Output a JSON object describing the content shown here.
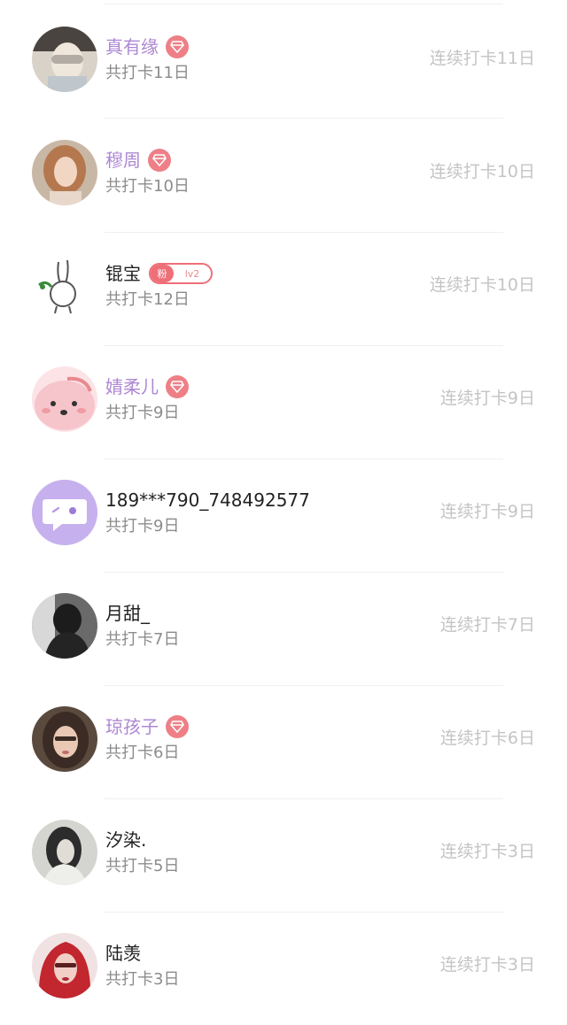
{
  "colors": {
    "vip_name": "#ad87d3",
    "normal_name": "#222222",
    "total_text": "#8c8c8c",
    "streak_text": "#c4c4c4",
    "vip_badge": "#ee7f86",
    "fan_badge": "#ee6f78"
  },
  "users": [
    {
      "name": "真有缘",
      "vip": true,
      "total": "共打卡11日",
      "streak": "连续打卡11日",
      "avatar_icon": "avatar-photo-icon"
    },
    {
      "name": "穆周",
      "vip": true,
      "total": "共打卡10日",
      "streak": "连续打卡10日",
      "avatar_icon": "avatar-photo-icon"
    },
    {
      "name": "锟宝",
      "vip": false,
      "fan_badge": {
        "label": "粉",
        "level": "lv2"
      },
      "total": "共打卡12日",
      "streak": "连续打卡10日",
      "avatar_icon": "rabbit-drawing-icon"
    },
    {
      "name": "婧柔儿",
      "vip": true,
      "total": "共打卡9日",
      "streak": "连续打卡9日",
      "avatar_icon": "pink-cartoon-icon"
    },
    {
      "name": "189***790_748492577",
      "vip": false,
      "total": "共打卡9日",
      "streak": "连续打卡9日",
      "avatar_icon": "chat-bubble-icon"
    },
    {
      "name": "月甜_",
      "vip": false,
      "total": "共打卡7日",
      "streak": "连续打卡7日",
      "avatar_icon": "avatar-photo-icon"
    },
    {
      "name": "琼孩子",
      "vip": true,
      "total": "共打卡6日",
      "streak": "连续打卡6日",
      "avatar_icon": "avatar-photo-icon"
    },
    {
      "name": "汐染.",
      "vip": false,
      "total": "共打卡5日",
      "streak": "连续打卡3日",
      "avatar_icon": "avatar-photo-icon"
    },
    {
      "name": "陆羡",
      "vip": false,
      "total": "共打卡3日",
      "streak": "连续打卡3日",
      "avatar_icon": "avatar-photo-icon"
    }
  ]
}
